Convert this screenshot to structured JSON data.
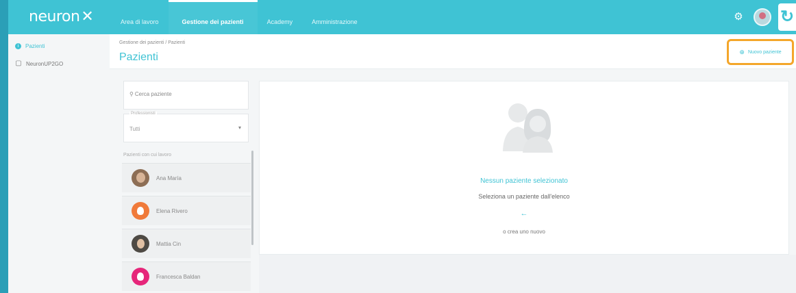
{
  "app": {
    "logo": "neuron",
    "logo_mark": "✕"
  },
  "nav": [
    {
      "label": "Area di lavoro"
    },
    {
      "label": "Gestione dei pazienti",
      "active": true
    },
    {
      "label": "Academy"
    },
    {
      "label": "Amministrazione"
    }
  ],
  "topbar_icons": {
    "settings": "gear-icon",
    "user": "user-avatar",
    "brand": "neuron-corner-logo"
  },
  "sidebar": [
    {
      "label": "Pazienti",
      "icon": "info-icon",
      "active": true
    },
    {
      "label": "NeuronUP2GO",
      "icon": "device-icon"
    }
  ],
  "header": {
    "breadcrumb": "Gestione dei pazienti / Pazienti",
    "title": "Pazienti",
    "new_button": "Nuovo paziente"
  },
  "list_panel": {
    "search_placeholder": "Cerca paziente",
    "select_label": "Professionisti",
    "select_value": "Tutti",
    "list_heading": "Pazienti con cui lavoro",
    "patients": [
      {
        "name": "Ana María",
        "avatar": "photo"
      },
      {
        "name": "Elena Rivero",
        "avatar": "orange-silhouette"
      },
      {
        "name": "Mattia Cin",
        "avatar": "photo"
      },
      {
        "name": "Francesca Baldan",
        "avatar": "pink-silhouette"
      }
    ]
  },
  "empty_state": {
    "title": "Nessun paziente selezionato",
    "subtitle": "Seleziona un paziente dall'elenco",
    "arrow": "←",
    "create_hint": "o crea uno nuovo"
  },
  "colors": {
    "accent": "#3fc3d4",
    "highlight": "#f4a62a",
    "orange": "#f07a3a",
    "pink": "#e6267a"
  }
}
